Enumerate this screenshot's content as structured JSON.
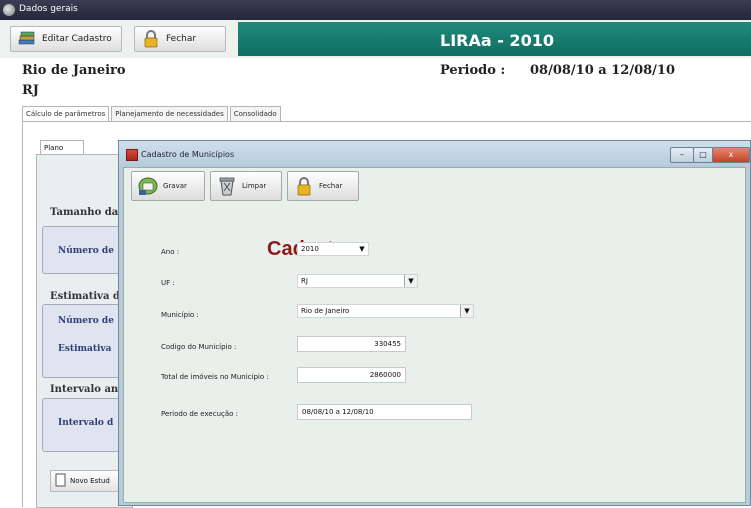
{
  "main_window": {
    "title": "Dados gerais",
    "toolbar": {
      "edit_label": "Editar Cadastro",
      "close_label": "Fechar"
    },
    "report_title": "LIRAa - 2010",
    "city": "Rio de Janeiro",
    "state": "RJ",
    "period_label": "Periodo :",
    "period_value": "08/08/10 a 12/08/10",
    "tabs": [
      "Cálculo de parâmetros",
      "Planejamento de necessidades",
      "Consolidado"
    ],
    "subtab": "Plano amostral",
    "groups": {
      "tamanho_title": "Tamanho da",
      "numero_label_1": "Número de",
      "estimativa_title": "Estimativa d",
      "numero_label_2": "Número de",
      "estimativa_label": "Estimativa",
      "intervalo_title": "Intervalo an",
      "intervalo_label": "Intervalo d"
    },
    "new_button_label": "Novo Estud"
  },
  "dialog": {
    "title": "Cadastro de Municípios",
    "buttons": {
      "save": "Gravar",
      "clear": "Limpar",
      "close": "Fechar"
    },
    "heading": "Cadastro",
    "fields": {
      "ano": {
        "label": "Ano :",
        "value": "2010"
      },
      "uf": {
        "label": "UF :",
        "value": "RJ"
      },
      "municipio": {
        "label": "Município :",
        "value": "Rio de Janeiro"
      },
      "codigo": {
        "label": "Codigo do Município :",
        "value": "330455"
      },
      "imoveis": {
        "label": "Total de imóveis no Município :",
        "value": "2860000"
      },
      "periodo": {
        "label": "Periodo de execução :",
        "value": "08/08/10 a 12/08/10"
      }
    },
    "window_controls": {
      "minimize": "–",
      "maximize": "□",
      "close": "x"
    }
  },
  "colors": {
    "teal_band": "#157c70",
    "heading_red": "#8b1a1a",
    "label_blue": "#2e3f78",
    "dialog_frame": "#b7cbd9"
  },
  "icons": {
    "edit": "book-stack-icon",
    "close": "padlock-icon",
    "save": "save-disk-icon",
    "clear": "trash-can-icon"
  }
}
